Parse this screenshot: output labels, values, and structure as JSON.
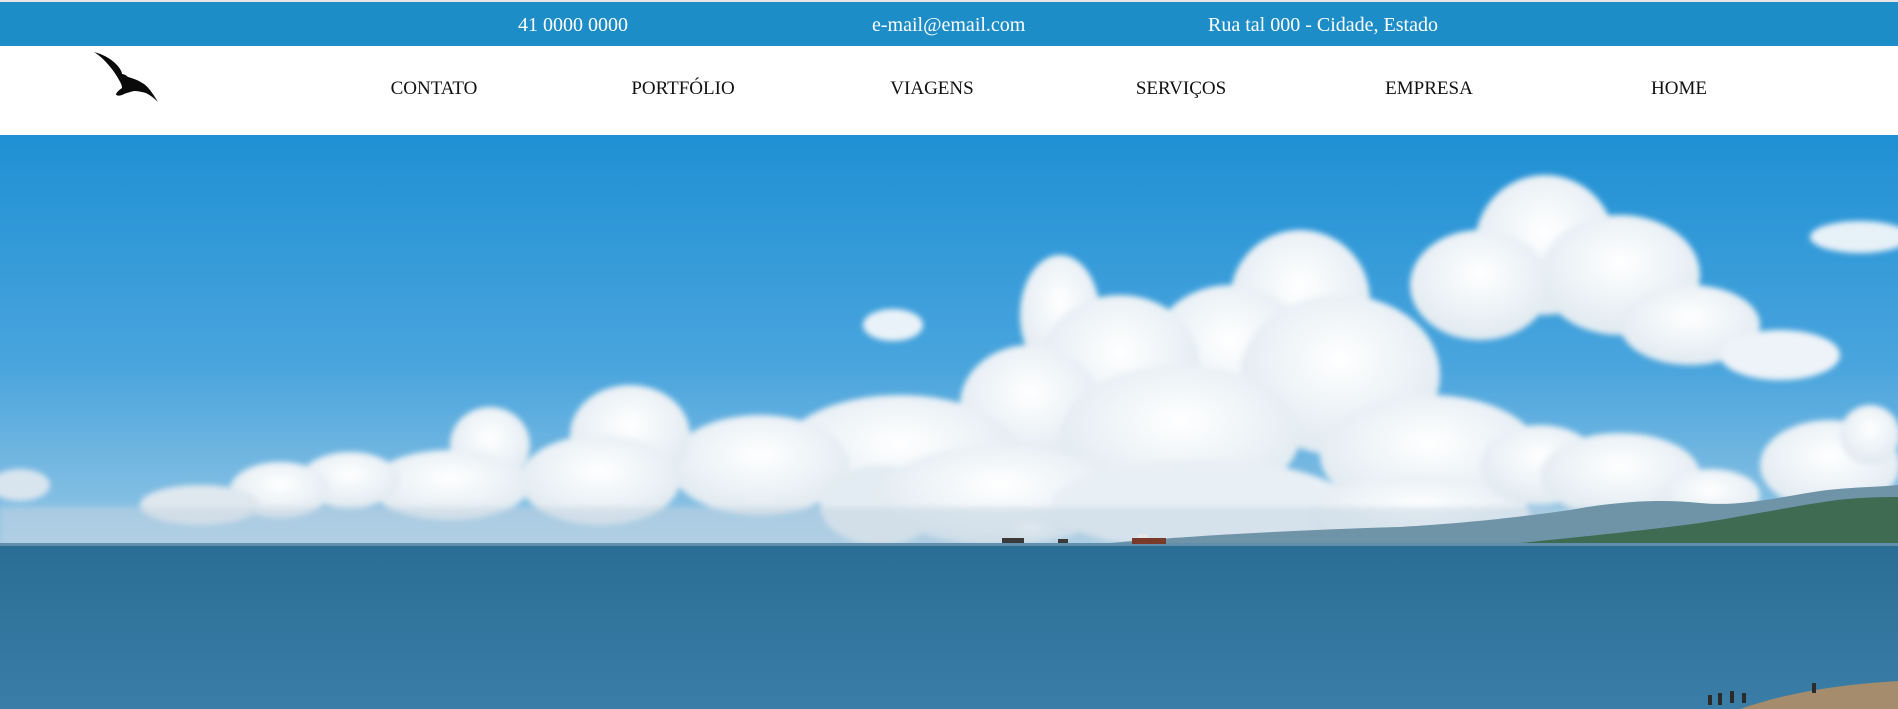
{
  "topbar": {
    "phone": "41 0000 0000",
    "email": "e-mail@email.com",
    "address": "Rua tal 000 - Cidade, Estado",
    "background": "#1d8dc8"
  },
  "logo": {
    "icon": "bird-icon"
  },
  "nav": {
    "items": [
      {
        "label": "CONTATO"
      },
      {
        "label": "PORTFÓLIO"
      },
      {
        "label": "VIAGENS"
      },
      {
        "label": "SERVIÇOS"
      },
      {
        "label": "EMPRESA"
      },
      {
        "label": "HOME"
      }
    ]
  },
  "hero": {
    "image": "sky-clouds-sea-photo",
    "sky_color": "#2f98d6",
    "sea_color": "#2f6f95"
  }
}
